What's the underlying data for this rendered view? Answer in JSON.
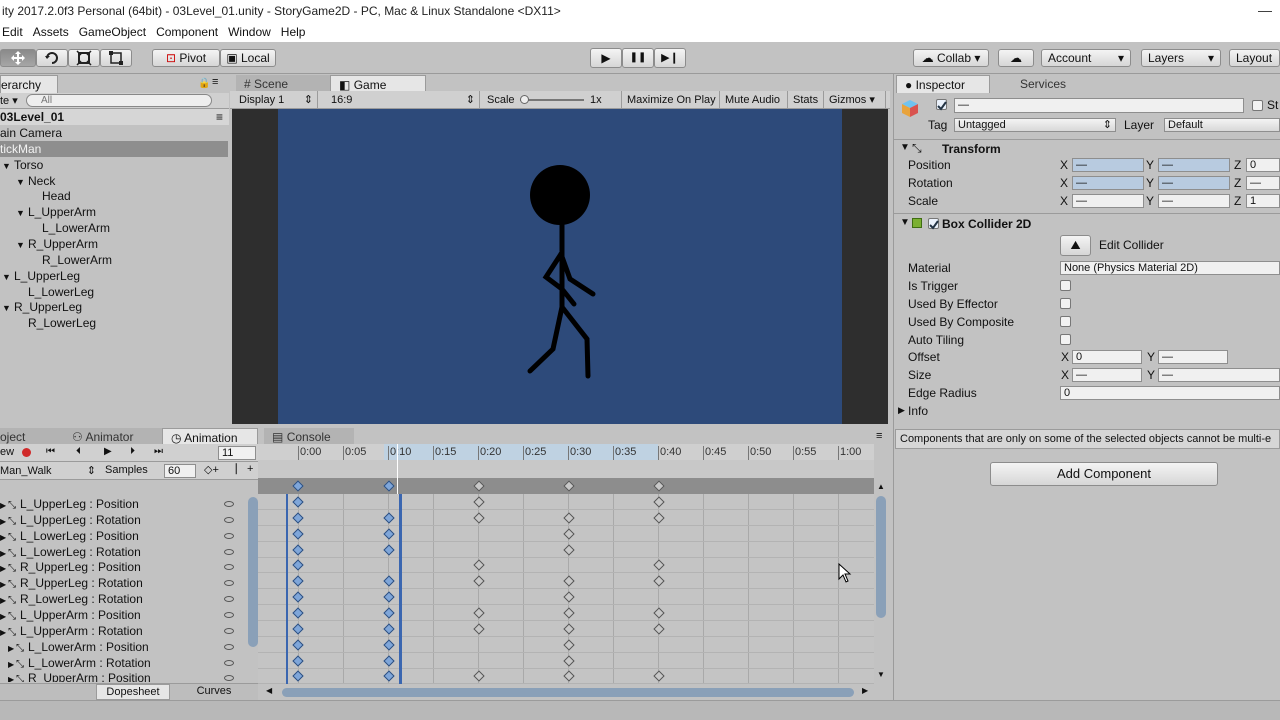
{
  "window": {
    "title": "ity 2017.2.0f3 Personal (64bit) - 03Level_01.unity - StoryGame2D - PC, Mac & Linux Standalone <DX11>",
    "minimize": "—",
    "restore": "❐"
  },
  "menu": [
    "Edit",
    "Assets",
    "GameObject",
    "Component",
    "Window",
    "Help"
  ],
  "toolbar": {
    "pivot": "Pivot",
    "local": "Local",
    "play": "▶",
    "pause": "❚❚",
    "step": "▶❙",
    "collab": "Collab ▾",
    "account": "Account",
    "layers": "Layers",
    "layout": "Layout",
    "dropdown_arrow": "▾"
  },
  "hierarchy": {
    "tab": "erarchy",
    "search_placeholder": "All",
    "create": "te ▾",
    "scene": "03Level_01",
    "items": [
      {
        "label": "ain Camera",
        "indent": 0,
        "sel": false
      },
      {
        "label": "tickMan",
        "indent": 0,
        "sel": true
      },
      {
        "label": "Torso",
        "indent": 1,
        "arrow": "▼",
        "sel": false
      },
      {
        "label": "Neck",
        "indent": 2,
        "arrow": "▼",
        "sel": false
      },
      {
        "label": "Head",
        "indent": 3,
        "sel": false
      },
      {
        "label": "L_UpperArm",
        "indent": 2,
        "arrow": "▼",
        "sel": false
      },
      {
        "label": "L_LowerArm",
        "indent": 3,
        "sel": false
      },
      {
        "label": "R_UpperArm",
        "indent": 2,
        "arrow": "▼",
        "sel": false
      },
      {
        "label": "R_LowerArm",
        "indent": 3,
        "sel": false
      },
      {
        "label": "L_UpperLeg",
        "indent": 1,
        "arrow": "▼",
        "sel": false
      },
      {
        "label": "L_LowerLeg",
        "indent": 2,
        "sel": false
      },
      {
        "label": "R_UpperLeg",
        "indent": 1,
        "arrow": "▼",
        "sel": false
      },
      {
        "label": "R_LowerLeg",
        "indent": 2,
        "sel": false
      }
    ]
  },
  "center_tabs": {
    "scene": "Scene",
    "game": "Game"
  },
  "game_bar": {
    "display": "Display 1",
    "aspect": "16:9",
    "scale_label": "Scale",
    "scale_value": "1x",
    "maximize": "Maximize On Play",
    "mute": "Mute Audio",
    "stats": "Stats",
    "gizmos": "Gizmos"
  },
  "bottom_tabs": {
    "project": "oject",
    "animator": "Animator",
    "animation": "Animation",
    "console": "Console"
  },
  "animation": {
    "preview": "ew",
    "frame": "11",
    "clip": "Man_Walk",
    "samples_label": "Samples",
    "samples": "60",
    "dopesheet": "Dopesheet",
    "curves": "Curves",
    "ticks": [
      "0:00",
      "0:05",
      "0:10",
      "0:15",
      "0:20",
      "0:25",
      "0:30",
      "0:35",
      "0:40",
      "0:45",
      "0:50",
      "0:55",
      "1:00"
    ],
    "properties": [
      "L_UpperLeg : Position",
      "L_UpperLeg : Rotation",
      "L_LowerLeg : Position",
      "L_LowerLeg : Rotation",
      "R_UpperLeg : Position",
      "R_UpperLeg : Rotation",
      "R_LowerLeg : Rotation",
      "L_UpperArm : Position",
      "L_UpperArm : Rotation",
      "L_LowerArm : Position",
      "L_LowerArm : Rotation",
      "R_UpperArm : Position"
    ]
  },
  "inspector": {
    "tab": "Inspector",
    "services": "Services",
    "name_value": "—",
    "static": "St",
    "tag_label": "Tag",
    "tag_value": "Untagged",
    "layer_label": "Layer",
    "layer_value": "Default",
    "transform": {
      "title": "Transform",
      "position": "Position",
      "rotation": "Rotation",
      "scale": "Scale",
      "dash": "—",
      "pos_z": "0",
      "scale_z": "1",
      "x": "X",
      "y": "Y",
      "z": "Z"
    },
    "collider": {
      "title": "Box Collider 2D",
      "edit": "Edit Collider",
      "material_label": "Material",
      "material_value": "None (Physics Material 2D)",
      "is_trigger": "Is Trigger",
      "used_by_effector": "Used By Effector",
      "used_by_composite": "Used By Composite",
      "auto_tiling": "Auto Tiling",
      "offset": "Offset",
      "offset_x": "0",
      "size": "Size",
      "edge_radius": "Edge Radius",
      "edge_radius_value": "0",
      "info": "Info"
    },
    "note": "Components that are only on some of the selected objects cannot be multi-e",
    "add_component": "Add Component"
  },
  "colors": {
    "game_bg": "#2d4a7a",
    "stick": "#000000",
    "selected_key": "#7fa6d9"
  }
}
